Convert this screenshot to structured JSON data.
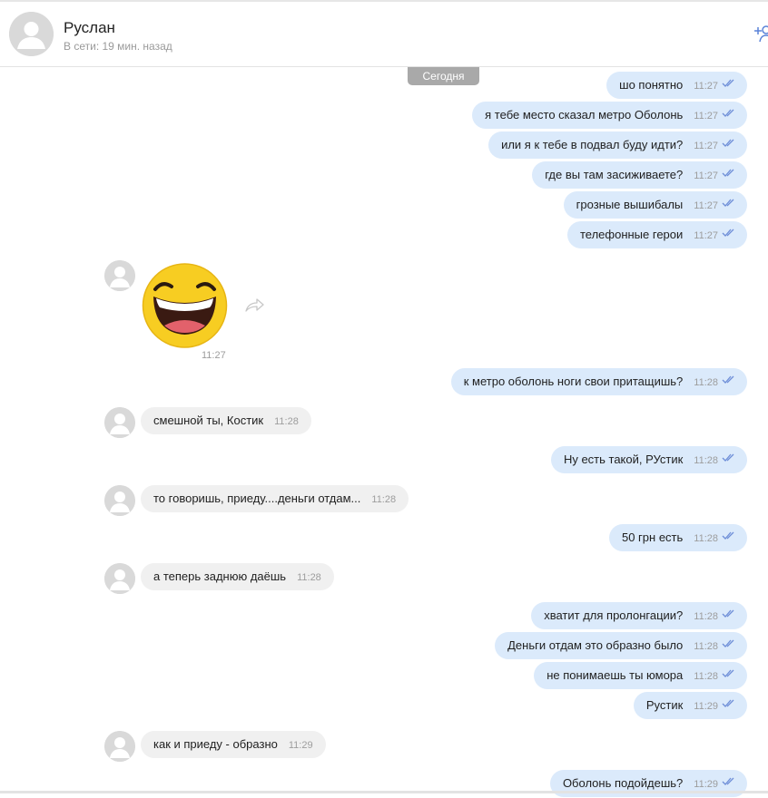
{
  "header": {
    "name": "Руслан",
    "status": "В сети: 19 мин. назад"
  },
  "chat": {
    "date_label": "Сегодня",
    "messages": [
      {
        "dir": "out",
        "text": "шо понятно",
        "time": "11:27"
      },
      {
        "dir": "out",
        "text": "я тебе место сказал метро Оболонь",
        "time": "11:27"
      },
      {
        "dir": "out",
        "text": "или я к тебе в подвал буду идти?",
        "time": "11:27"
      },
      {
        "dir": "out",
        "text": "где вы там засиживаете?",
        "time": "11:27"
      },
      {
        "dir": "out",
        "text": "грозные вышибалы",
        "time": "11:27"
      },
      {
        "dir": "out",
        "text": "телефонные герои",
        "time": "11:27"
      },
      {
        "dir": "in",
        "type": "sticker",
        "sticker": "laughing-face",
        "time": "11:27"
      },
      {
        "dir": "out",
        "text": "к метро оболонь ноги свои притащишь?",
        "time": "11:28"
      },
      {
        "dir": "in",
        "text": "смешной ты, Костик",
        "time": "11:28"
      },
      {
        "dir": "out",
        "text": "Ну есть такой, РУстик",
        "time": "11:28"
      },
      {
        "dir": "in",
        "text": "то говоришь, приеду....деньги отдам...",
        "time": "11:28"
      },
      {
        "dir": "out",
        "text": "50 грн есть",
        "time": "11:28"
      },
      {
        "dir": "in",
        "text": "а теперь заднюю даёшь",
        "time": "11:28"
      },
      {
        "dir": "out",
        "text": "хватит для пролонгации?",
        "time": "11:28"
      },
      {
        "dir": "out",
        "text": "Деньги отдам это образно было",
        "time": "11:28"
      },
      {
        "dir": "out",
        "text": "не понимаешь ты юмора",
        "time": "11:28"
      },
      {
        "dir": "out",
        "text": "Рустик",
        "time": "11:29"
      },
      {
        "dir": "in",
        "text": "как и приеду - образно",
        "time": "11:29"
      },
      {
        "dir": "out",
        "text": "Оболонь подойдешь?",
        "time": "11:29"
      }
    ]
  },
  "colors": {
    "outgoing_bubble": "#dbeafb",
    "incoming_bubble": "#f0f0f0",
    "read_check": "#6f8fd8",
    "date_pill": "#a9a9a9"
  }
}
